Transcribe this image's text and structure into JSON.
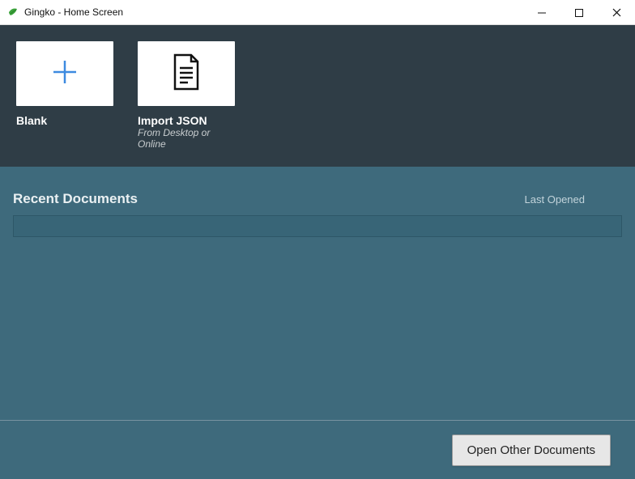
{
  "window": {
    "title": "Gingko - Home Screen"
  },
  "templates": {
    "blank": {
      "title": "Blank"
    },
    "import": {
      "title": "Import JSON",
      "subtitle": "From Desktop or Online"
    }
  },
  "recent": {
    "heading": "Recent Documents",
    "last_opened_label": "Last Opened"
  },
  "footer": {
    "open_other": "Open Other Documents"
  }
}
